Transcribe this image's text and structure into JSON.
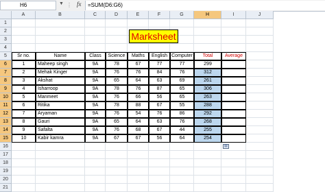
{
  "formula_bar": {
    "name_box": "H6",
    "fx": "fx",
    "formula": "=SUM(D6:G6)"
  },
  "columns": [
    "A",
    "B",
    "C",
    "D",
    "E",
    "F",
    "G",
    "H",
    "I",
    "J"
  ],
  "rows": [
    "1",
    "2",
    "3",
    "4",
    "5",
    "6",
    "7",
    "8",
    "9",
    "10",
    "11",
    "12",
    "13",
    "14",
    "15",
    "16",
    "17",
    "18",
    "19",
    "20",
    "21"
  ],
  "sheet_title": "Marksheet",
  "headers": {
    "sr": "Sr no.",
    "name": "Name",
    "class": "Class",
    "science": "Science",
    "maths": "Maths",
    "english": "English",
    "computer": "Computer",
    "total": "Total",
    "average": "Average"
  },
  "students": [
    {
      "sr": "1",
      "name": "Maheep singh",
      "class": "9A",
      "science": "78",
      "maths": "67",
      "english": "77",
      "computer": "77",
      "total": "299"
    },
    {
      "sr": "2",
      "name": "Mehak Kinger",
      "class": "9A",
      "science": "76",
      "maths": "76",
      "english": "84",
      "computer": "76",
      "total": "312"
    },
    {
      "sr": "3",
      "name": "Akshat",
      "class": "9A",
      "science": "65",
      "maths": "64",
      "english": "63",
      "computer": "69",
      "total": "261"
    },
    {
      "sr": "4",
      "name": "Isharroop",
      "class": "9A",
      "science": "78",
      "maths": "76",
      "english": "87",
      "computer": "65",
      "total": "306"
    },
    {
      "sr": "5",
      "name": "Manmeet",
      "class": "9A",
      "science": "76",
      "maths": "66",
      "english": "56",
      "computer": "65",
      "total": "263"
    },
    {
      "sr": "6",
      "name": "Ritika",
      "class": "9A",
      "science": "78",
      "maths": "88",
      "english": "67",
      "computer": "55",
      "total": "288"
    },
    {
      "sr": "7",
      "name": "Aryaman",
      "class": "9A",
      "science": "76",
      "maths": "54",
      "english": "76",
      "computer": "86",
      "total": "292"
    },
    {
      "sr": "8",
      "name": "Gauri",
      "class": "9A",
      "science": "65",
      "maths": "64",
      "english": "63",
      "computer": "76",
      "total": "268"
    },
    {
      "sr": "9",
      "name": "Safalta",
      "class": "9A",
      "science": "76",
      "maths": "68",
      "english": "67",
      "computer": "44",
      "total": "255"
    },
    {
      "sr": "10",
      "name": "Kabir kamra",
      "class": "9A",
      "science": "67",
      "maths": "67",
      "english": "56",
      "computer": "64",
      "total": "254"
    }
  ]
}
